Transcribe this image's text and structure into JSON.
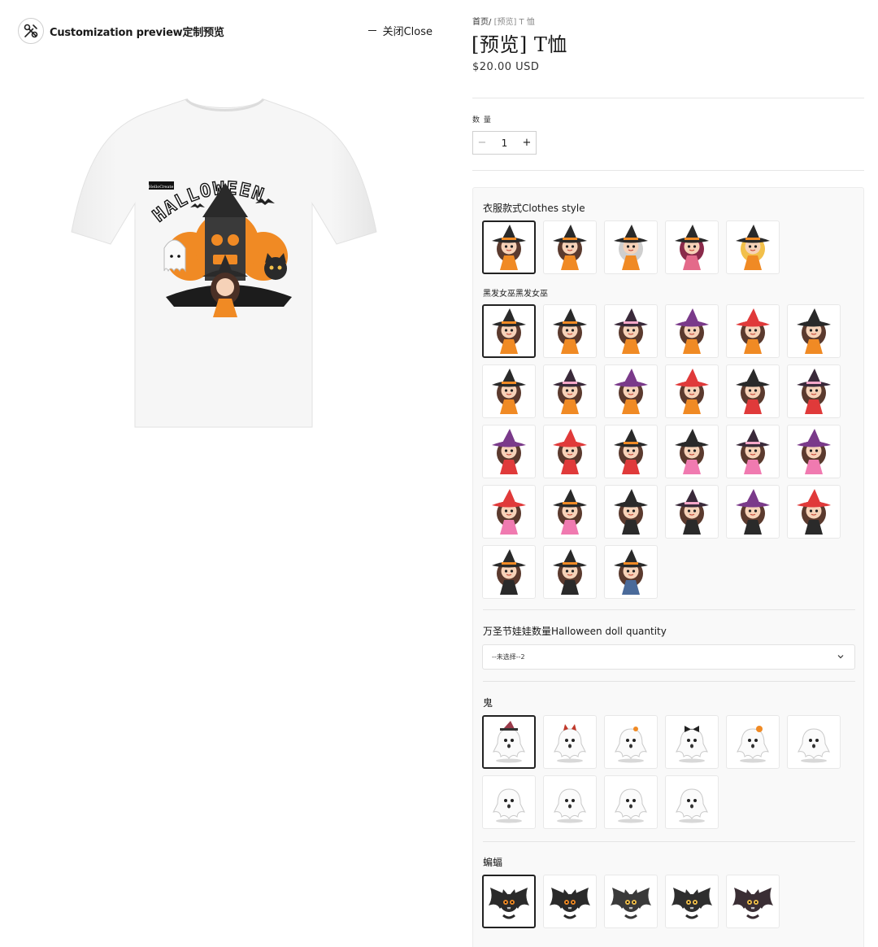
{
  "preview": {
    "title": "Customization preview定制预览",
    "close_label": "关闭Close"
  },
  "product": {
    "breadcrumb_home": "首页/",
    "breadcrumb_current": "[预览] T 恤",
    "title": "[预览] T恤",
    "price": "$20.00 USD"
  },
  "quantity": {
    "label": "数 量",
    "value": "1",
    "minus": "−",
    "plus": "+"
  },
  "options": {
    "clothes_style_label": "衣服款式Clothes style",
    "witch_label": "黑发女巫黑发女巫",
    "doll_qty_label": "万圣节娃娃数量Halloween doll quantity",
    "doll_qty_selected": "--未选择--2",
    "ghost_label": "鬼",
    "bat_label": "蝙蝠"
  },
  "clothes_styles": [
    {
      "hat": "#2a2a2a",
      "hair": "#5b3a2e",
      "dress": "#f08a24",
      "brim": "#f08a24"
    },
    {
      "hat": "#2a2a2a",
      "hair": "#5b3a2e",
      "dress": "#f08a24",
      "brim": "#f08a24"
    },
    {
      "hat": "#2a2a2a",
      "hair": "#cfcfcf",
      "dress": "#f08a24",
      "brim": "#f08a24"
    },
    {
      "hat": "#2a2a2a",
      "hair": "#8a2a4a",
      "dress": "#e46a8a",
      "brim": "#f08a24"
    },
    {
      "hat": "#2a2a2a",
      "hair": "#f2c04a",
      "dress": "#f08a24",
      "brim": "#f08a24"
    }
  ],
  "witches": [
    {
      "hat": "#2a2a2a",
      "dress": "#f08a24",
      "brim": "#f08a24"
    },
    {
      "hat": "#2a2a2a",
      "dress": "#f08a24",
      "brim": "#f08a24"
    },
    {
      "hat": "#3a2a3a",
      "dress": "#f08a24",
      "brim": "#f5a6c8"
    },
    {
      "hat": "#7a3a8a",
      "dress": "#f08a24",
      "brim": "#7a3a8a"
    },
    {
      "hat": "#e03a3a",
      "dress": "#f08a24",
      "brim": "#e03a3a"
    },
    {
      "hat": "#2a2a2a",
      "dress": "#f08a24",
      "brim": "#2a2a2a"
    },
    {
      "hat": "#2a2a2a",
      "dress": "#f08a24",
      "brim": "#f08a24"
    },
    {
      "hat": "#3a2a3a",
      "dress": "#f08a24",
      "brim": "#f5a6c8"
    },
    {
      "hat": "#7a3a8a",
      "dress": "#f08a24",
      "brim": "#7a3a8a"
    },
    {
      "hat": "#e03a3a",
      "dress": "#f08a24",
      "brim": "#e03a3a"
    },
    {
      "hat": "#2a2a2a",
      "dress": "#e03a3a",
      "brim": "#2a2a2a"
    },
    {
      "hat": "#3a2a3a",
      "dress": "#e03a3a",
      "brim": "#f5a6c8"
    },
    {
      "hat": "#7a3a8a",
      "dress": "#e03a3a",
      "brim": "#7a3a8a"
    },
    {
      "hat": "#e03a3a",
      "dress": "#e03a3a",
      "brim": "#e03a3a"
    },
    {
      "hat": "#2a2a2a",
      "dress": "#e03a3a",
      "brim": "#f08a24"
    },
    {
      "hat": "#2a2a2a",
      "dress": "#f07ab0",
      "brim": "#2a2a2a"
    },
    {
      "hat": "#3a2a3a",
      "dress": "#f07ab0",
      "brim": "#f5a6c8"
    },
    {
      "hat": "#7a3a8a",
      "dress": "#f07ab0",
      "brim": "#7a3a8a"
    },
    {
      "hat": "#e03a3a",
      "dress": "#f07ab0",
      "brim": "#e03a3a"
    },
    {
      "hat": "#2a2a2a",
      "dress": "#f07ab0",
      "brim": "#f08a24"
    },
    {
      "hat": "#2a2a2a",
      "dress": "#2a2a2a",
      "brim": "#2a2a2a"
    },
    {
      "hat": "#3a2a3a",
      "dress": "#2a2a2a",
      "brim": "#f5a6c8"
    },
    {
      "hat": "#7a3a8a",
      "dress": "#2a2a2a",
      "brim": "#7a3a8a"
    },
    {
      "hat": "#e03a3a",
      "dress": "#2a2a2a",
      "brim": "#e03a3a"
    },
    {
      "hat": "#2a2a2a",
      "dress": "#2a2a2a",
      "brim": "#f08a24"
    },
    {
      "hat": "#2a2a2a",
      "dress": "#2a2a2a",
      "brim": "#f08a24"
    },
    {
      "hat": "#2a2a2a",
      "dress": "#4a6a9a",
      "brim": "#f08a24"
    }
  ],
  "ghosts": [
    {
      "accent": "#9a3a4a",
      "kind": "hat"
    },
    {
      "accent": "#c0392b",
      "kind": "horns"
    },
    {
      "accent": "#f08a24",
      "kind": "flower"
    },
    {
      "accent": "#222222",
      "kind": "bow"
    },
    {
      "accent": "#f08a24",
      "kind": "pumpkin"
    },
    {
      "accent": "#222222",
      "kind": "plain"
    },
    {
      "accent": "#222222",
      "kind": "plain"
    },
    {
      "accent": "#222222",
      "kind": "plain"
    },
    {
      "accent": "#222222",
      "kind": "plain"
    },
    {
      "accent": "#222222",
      "kind": "plain"
    }
  ],
  "bats": [
    {
      "body": "#2a2a2a",
      "eye": "#f08a24"
    },
    {
      "body": "#2a2a2a",
      "eye": "#f08a24"
    },
    {
      "body": "#3a3a3a",
      "eye": "#f2c04a"
    },
    {
      "body": "#2e2e2e",
      "eye": "#f2c04a"
    },
    {
      "body": "#3a2e34",
      "eye": "#f2c04a"
    }
  ],
  "shirt": {
    "print_text": "HALLOWEEN",
    "print_tag": "HelloCreate"
  }
}
